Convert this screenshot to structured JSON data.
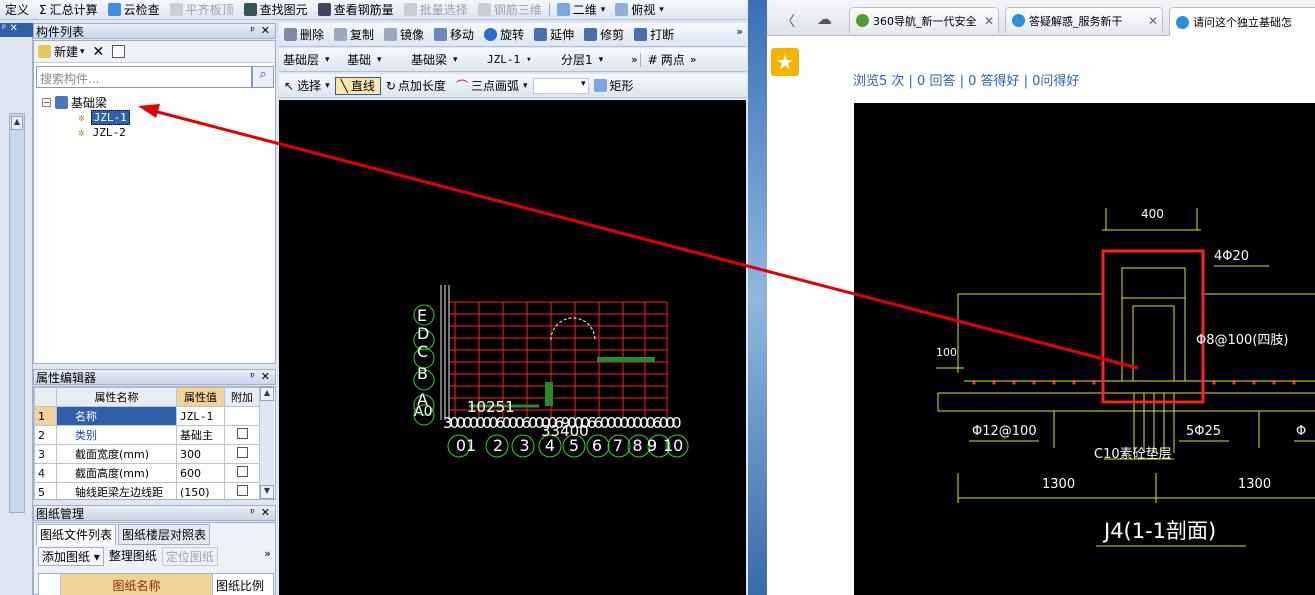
{
  "toolbar1": {
    "items": [
      "定义",
      "汇总计算",
      "云检查",
      "平齐板顶",
      "查找图元",
      "查看钢筋量",
      "批量选择",
      "钢筋三维",
      "二维",
      "俯视"
    ]
  },
  "toolbar2": {
    "items": [
      "删除",
      "复制",
      "镜像",
      "移动",
      "旋转",
      "延伸",
      "修剪",
      "打断"
    ],
    "more": "»"
  },
  "toolbar3": {
    "dropdowns": [
      "基础层",
      "基础",
      "基础梁",
      "JZL-1",
      "分层1"
    ],
    "two_points": "两点",
    "more": "»"
  },
  "toolbar4": {
    "select": "选择",
    "line": "直线",
    "point_length": "点加长度",
    "arc": "三点画弧",
    "rect": "矩形"
  },
  "component_list": {
    "title": "构件列表",
    "new_label": "新建",
    "search_placeholder": "搜索构件...",
    "tree_root": "基础梁",
    "items": [
      "JZL-1",
      "JZL-2"
    ]
  },
  "property_editor": {
    "title": "属性编辑器",
    "headers": [
      "属性名称",
      "属性值",
      "附加"
    ],
    "rows": [
      {
        "num": "1",
        "name": "名称",
        "value": "JZL-1"
      },
      {
        "num": "2",
        "name": "类别",
        "value": "基础主"
      },
      {
        "num": "3",
        "name": "截面宽度(mm)",
        "value": "300"
      },
      {
        "num": "4",
        "name": "截面高度(mm)",
        "value": "600"
      },
      {
        "num": "5",
        "name": "轴线距梁左边线距",
        "value": "(150)"
      }
    ]
  },
  "drawing_manager": {
    "title": "图纸管理",
    "tabs": [
      "图纸文件列表",
      "图纸楼层对照表"
    ],
    "buttons": [
      "添加图纸",
      "整理图纸",
      "定位图纸"
    ],
    "headers": [
      "图纸名称",
      "图纸比例"
    ]
  },
  "cad": {
    "row_labels": [
      "E",
      "D",
      "C",
      "B",
      "A",
      "A0"
    ],
    "col_labels": [
      "01",
      "2",
      "3",
      "4",
      "5",
      "6",
      "7",
      "8",
      "9",
      "10"
    ],
    "dim_total": "33400",
    "dim_small": "10251",
    "dim_bottom": "300000006000600006900066000000006000"
  },
  "browser": {
    "tabs": [
      "360导航_新一代安全",
      "答疑解惑_服务新干",
      "请问这个独立基础怎"
    ],
    "stats": "浏览5 次 | 0 回答 | 0 答得好 | 0问得好",
    "drawing": {
      "dim_400": "400",
      "rebar_top": "4Φ20",
      "stirrup": "Φ8@100(四肢)",
      "dim_100": "100",
      "bottom_rebar": "Φ12@100",
      "side_rebar": "5Φ25",
      "cushion": "C10素砼垫层",
      "dim_left": "1300",
      "dim_right": "1300",
      "section_title": "J4(1-1剖面)",
      "cut_prefix": "Φ"
    }
  },
  "colors": {
    "grid_red": "#ff2020",
    "cad_green": "#22dd22",
    "cad_yellow": "#e6e600",
    "arrow_red": "#e30000",
    "link_blue": "#2a63b6"
  }
}
